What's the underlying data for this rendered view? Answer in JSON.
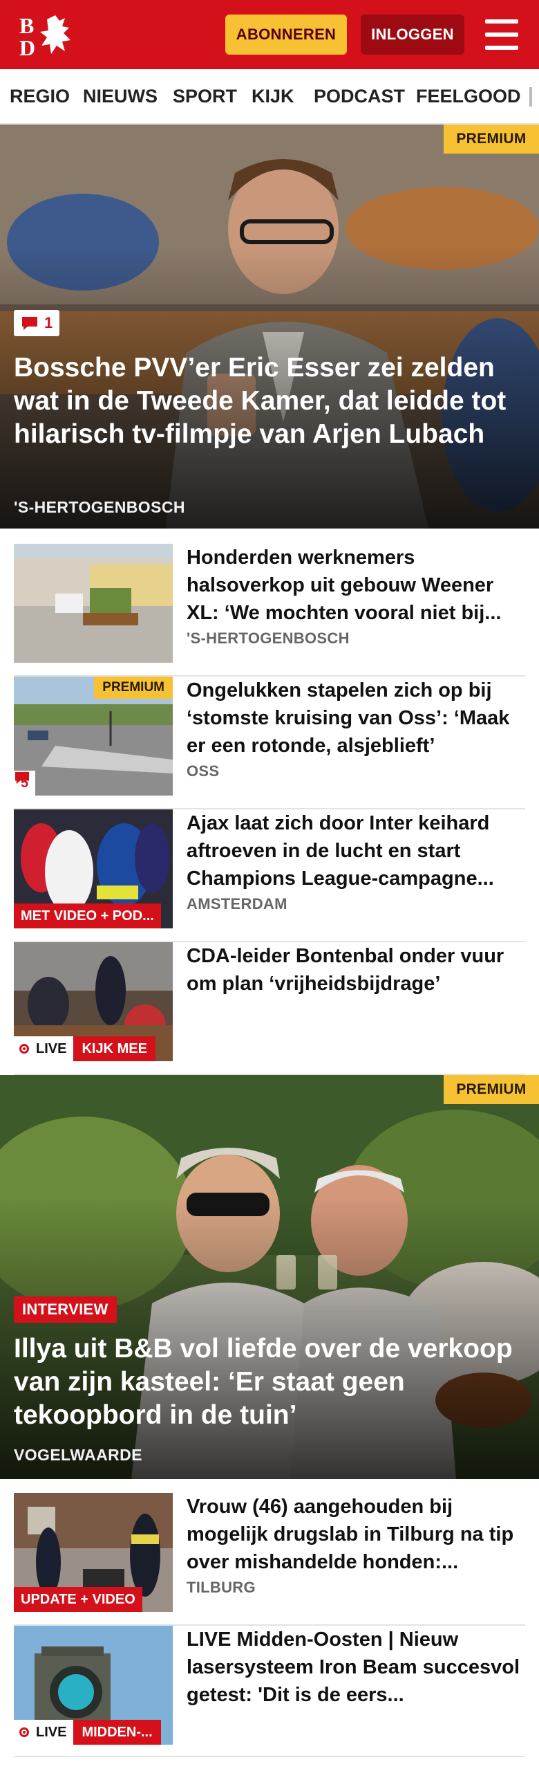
{
  "header": {
    "logo_text": "BD",
    "subscribe_label": "ABONNEREN",
    "login_label": "INLOGGEN"
  },
  "nav": {
    "items": [
      "REGIO",
      "NIEUWS",
      "SPORT",
      "KIJK",
      "PODCAST",
      "FEELGOOD"
    ]
  },
  "hero1": {
    "premium_label": "PREMIUM",
    "comments": "1",
    "title": "Bossche PVV’er Eric Esser zei zelden wat in de Tweede Kamer, dat leidde tot hilarisch tv-filmpje van Arjen Lubach",
    "location": "'S-HERTOGENBOSCH"
  },
  "articles": [
    {
      "title": "Honderden werknemers halsoverkop uit gebouw Weener XL: ‘We mochten vooral niet bij...",
      "location": "'S-HERTOGENBOSCH"
    },
    {
      "title": "Ongelukken stapelen zich op bij ‘stomste kruising van Oss’: ‘Maak er een rotonde, alsjeblieft’",
      "location": "OSS",
      "premium_label": "PREMIUM",
      "comments": "5"
    },
    {
      "title": "Ajax laat zich door Inter keihard aftroeven in de lucht en start Champions League-campagne...",
      "location": "AMSTERDAM",
      "tag": "MET VIDEO + POD..."
    },
    {
      "title": "CDA-leider Bontenbal onder vuur om plan ‘vrijheidsbijdrage’",
      "live_label": "LIVE",
      "cta": "KIJK MEE"
    }
  ],
  "hero2": {
    "premium_label": "PREMIUM",
    "tag": "INTERVIEW",
    "title": "Illya uit B&B vol liefde over de verkoop van zijn kasteel: ‘Er staat geen tekoopbord in de tuin’",
    "location": "VOGELWAARDE"
  },
  "articles2": [
    {
      "title": "Vrouw (46) aangehouden bij mogelijk drugslab in Tilburg na tip over mishandelde honden:...",
      "location": "TILBURG",
      "tag": "UPDATE + VIDEO"
    },
    {
      "title": "LIVE Midden-Oosten | Nieuw lasersysteem Iron Beam succesvol getest: 'Dit is de eers...",
      "live_label": "LIVE",
      "cta": "MIDDEN-..."
    }
  ],
  "colors": {
    "brand_red": "#d4111a",
    "premium_yellow": "#f6c234",
    "login_dark_red": "#9e0a12"
  }
}
